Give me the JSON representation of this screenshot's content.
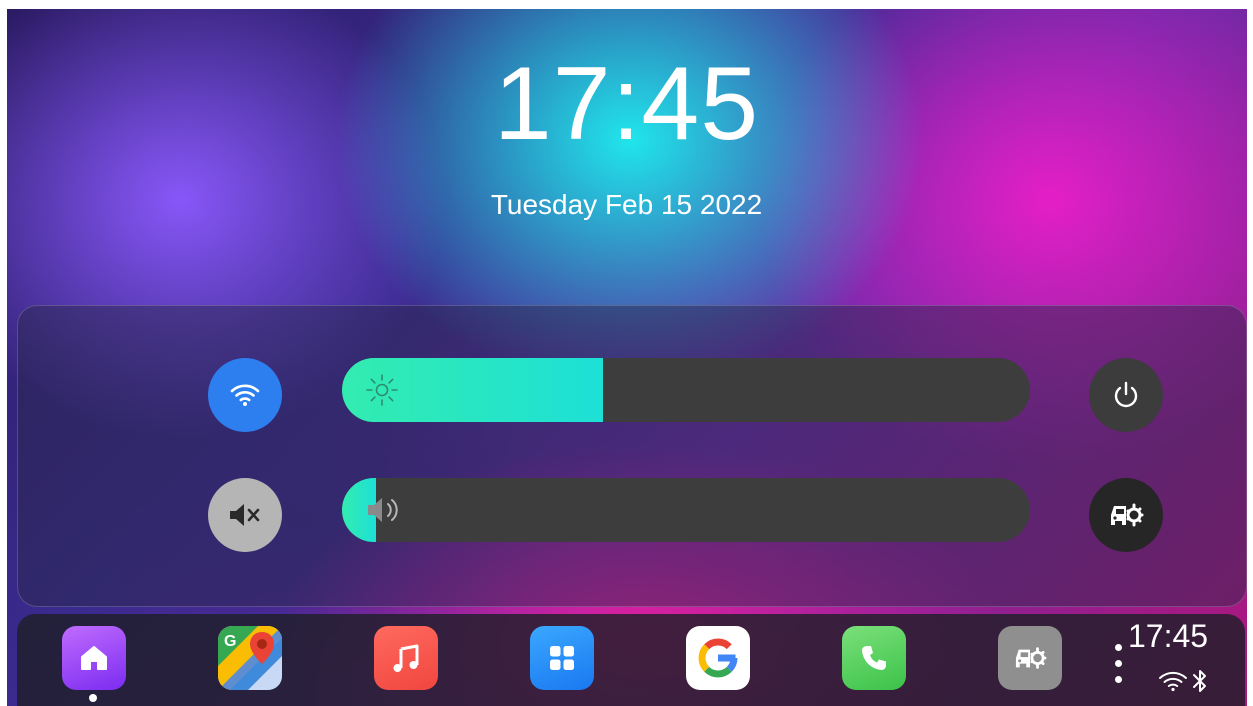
{
  "clock": {
    "time": "17:45",
    "date": "Tuesday Feb 15 2022"
  },
  "controls": {
    "wifi": {
      "icon": "wifi-icon",
      "color": "#2d7ff0",
      "enabled": true
    },
    "mute": {
      "icon": "volume-mute-icon",
      "color": "#b5b5b5",
      "muted": true
    },
    "power": {
      "icon": "power-icon"
    },
    "car_settings": {
      "icon": "car-settings-icon"
    },
    "brightness": {
      "icon": "sun-icon",
      "level": 0.38,
      "fill_color": "#33ecb0"
    },
    "volume": {
      "icon": "speaker-icon",
      "level": 0.05,
      "fill_color": "#33ecb0"
    }
  },
  "dock": {
    "apps": [
      {
        "name": "Home",
        "icon": "home-icon",
        "active": true
      },
      {
        "name": "Maps",
        "icon": "google-maps-icon"
      },
      {
        "name": "Music",
        "icon": "music-note-icon"
      },
      {
        "name": "App Grid",
        "icon": "app-grid-icon"
      },
      {
        "name": "Google",
        "icon": "google-icon"
      },
      {
        "name": "Phone",
        "icon": "phone-icon"
      },
      {
        "name": "Car Settings",
        "icon": "car-settings-icon"
      }
    ],
    "status": {
      "time": "17:45",
      "icons": [
        "wifi-icon",
        "bluetooth-icon"
      ]
    }
  }
}
